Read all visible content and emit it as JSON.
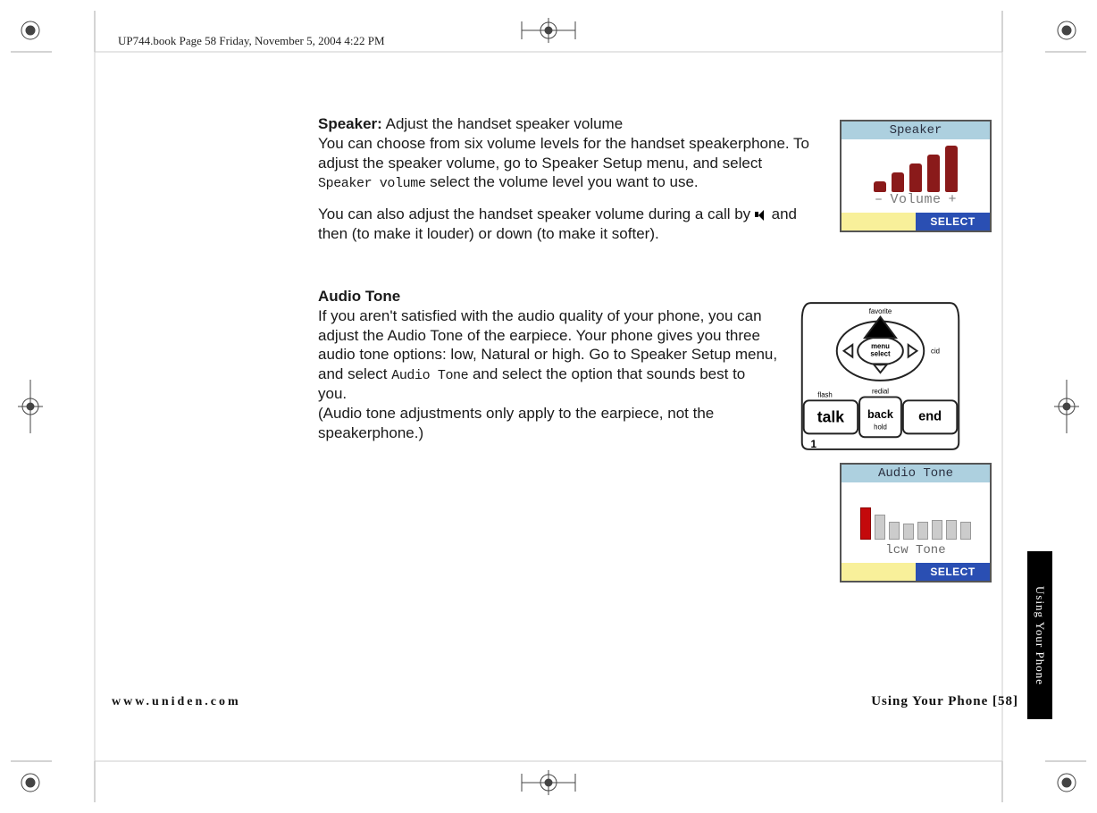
{
  "meta": {
    "print_header": "UP744.book  Page 58  Friday, November 5, 2004  4:22 PM"
  },
  "section1": {
    "heading": "Speaker:",
    "heading_rest": " Adjust the handset speaker volume",
    "para1a": "You can choose from six volume levels for the handset speakerphone. To adjust the speaker volume, go to Speaker Setup menu, and select ",
    "menu1": "Speaker volume",
    "para1b": " select the volume level you want to use.",
    "para2": "You can also adjust the handset speaker volume during a call by ",
    "para2b": " and then (to make it louder) or down (to make it softer)."
  },
  "section2": {
    "heading": "Audio Tone",
    "para1a": "If you aren't satisfied with the audio quality of your phone, you can adjust the Audio Tone of the earpiece. Your phone gives you three audio tone options: low, Natural or high. Go to Speaker Setup menu, and select ",
    "menu1": "Audio Tone",
    "para1b": " and select the option that sounds best to you.",
    "para2": "(Audio tone adjustments only apply to the earpiece, not the speakerphone.)"
  },
  "fig_speaker": {
    "title": "Speaker",
    "label_minus": "–",
    "label_text": "Volume",
    "label_plus": "+",
    "select": "SELECT"
  },
  "fig_audio": {
    "title": "Audio Tone",
    "label": "lcw Tone",
    "select": "SELECT"
  },
  "handset": {
    "favorite": "favorite",
    "menu": "menu",
    "select": "select",
    "cid": "cid",
    "book": "",
    "flash": "flash",
    "redial": "redial",
    "back": "back",
    "hold": "hold",
    "talk": "talk",
    "end": "end"
  },
  "sidetab": "Using Your Phone",
  "footer": {
    "url": "www.uniden.com",
    "page_label": "Using Your Phone [58]"
  }
}
